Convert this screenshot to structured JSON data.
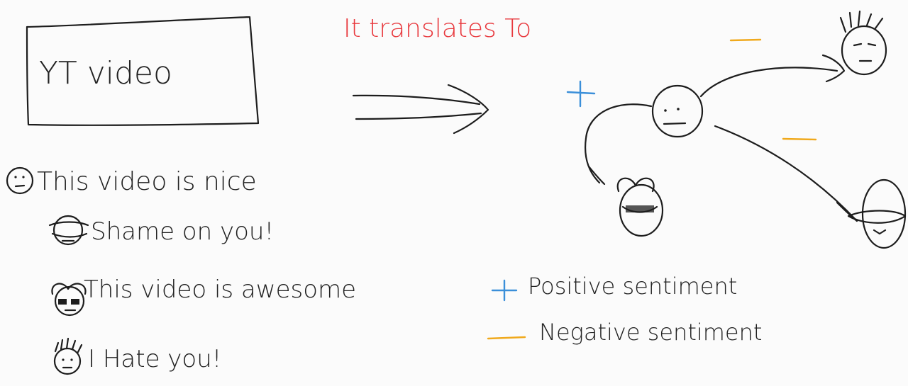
{
  "video_box": {
    "label": "YT video"
  },
  "comments": [
    {
      "text": "This video is nice",
      "face": "neutral-face-icon"
    },
    {
      "text": "Shame on you!",
      "face": "covered-face-icon"
    },
    {
      "text": "This video is awesome",
      "face": "sunglasses-face-icon"
    },
    {
      "text": "I Hate you!",
      "face": "spiky-hair-face-icon"
    }
  ],
  "arrow_caption": "It translates To",
  "graph": {
    "edges": [
      {
        "from": "center",
        "to": "bottom-left",
        "sign": "+"
      },
      {
        "from": "center",
        "to": "top-right",
        "sign": "—"
      },
      {
        "from": "center",
        "to": "bottom-right",
        "sign": "—"
      }
    ]
  },
  "legend": [
    {
      "symbol": "+",
      "label": "Positive sentiment",
      "color": "#3b8fd9"
    },
    {
      "symbol": "—",
      "label": "Negative sentiment",
      "color": "#f0a91c"
    }
  ],
  "colors": {
    "ink": "#1d1d1d",
    "caption": "#e8383d",
    "positive": "#3b8fd9",
    "negative": "#f0a91c"
  }
}
